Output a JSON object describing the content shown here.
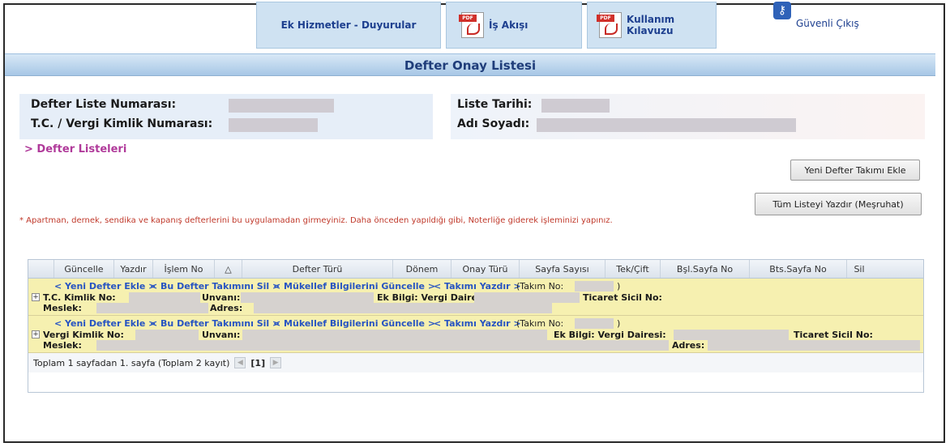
{
  "nav": {
    "ek_hizmetler": "Ek Hizmetler - Duyurular",
    "is_akisi": "İş Akışı",
    "kullanim_1": "Kullanım",
    "kullanim_2": "Kılavuzu",
    "logout": "Güvenli Çıkış",
    "pdf_tag": "PDF"
  },
  "page_title": "Defter Onay Listesi",
  "info": {
    "liste_no_label": "Defter Liste Numarası:",
    "tc_label": "T.C. / Vergi Kimlik Numarası:",
    "liste_tarihi_label": "Liste Tarihi:",
    "adi_soyadi_label": "Adı Soyadı:"
  },
  "link_defter_listeleri": "> Defter Listeleri",
  "buttons": {
    "yeni_takim": "Yeni Defter Takımı Ekle",
    "tum_liste": "Tüm Listeyi Yazdır (Meşruhat)"
  },
  "warning": "* Apartman, dernek, sendika ve kapanış defterlerini bu uygulamadan girmeyiniz. Daha önceden yapıldığı gibi, Noterliğe giderek işleminizi yapınız.",
  "grid": {
    "columns": [
      "Güncelle",
      "Yazdır",
      "İşlem No",
      "△",
      "Defter Türü",
      "Dönem",
      "Onay Türü",
      "Sayfa Sayısı",
      "Tek/Çift",
      "Bşl.Sayfa No",
      "Bts.Sayfa No",
      "Sil"
    ],
    "links": {
      "yeni_defter": "< Yeni Defter Ekle >",
      "takim_sil": "< Bu Defter Takımını Sil >",
      "mukellef": "< Mükellef Bilgilerini Güncelle >",
      "takim_yazdir": "< Takımı Yazdır >",
      "takim_no": "(Takım No:",
      "close_paren": ")"
    },
    "row1": {
      "tc": "T.C. Kimlik No:",
      "unvan": "Unvanı:",
      "ek_bilgi": "Ek Bilgi: Vergi Dairesi:",
      "ticaret": "Ticaret Sicil No:",
      "meslek": "Meslek:",
      "adres": "Adres:"
    },
    "row2": {
      "vkn": "Vergi Kimlik No:",
      "unvan": "Unvanı:",
      "ek_bilgi": "Ek Bilgi: Vergi Dairesi:",
      "ticaret": "Ticaret Sicil No:",
      "meslek": "Meslek:",
      "adres": "Adres:"
    },
    "pager": {
      "summary": "Toplam 1 sayfadan 1. sayfa (Toplam 2 kayıt)",
      "page": "[1]"
    }
  }
}
